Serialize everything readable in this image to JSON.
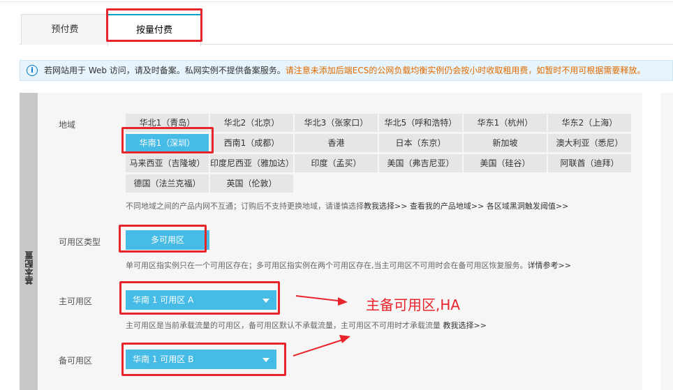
{
  "tabs": [
    {
      "label": "预付费"
    },
    {
      "label": "按量付费"
    }
  ],
  "info": {
    "normal": "若网站用于 Web 访问，请及时备案。私网实例不提供备案服务。",
    "warning": "请注意未添加后端ECS的公网负载均衡实例仍会按小时收取租用费，如暂时不用可根据需要释放。"
  },
  "side_label": "基本配置",
  "region": {
    "label": "地域",
    "rows": [
      [
        "华北1（青岛）",
        "华北2（北京）",
        "华北3（张家口）",
        "华北5（呼和浩特）",
        "华东1（杭州）",
        "华东2（上海）"
      ],
      [
        "华南1（深圳）",
        "西南1（成都）",
        "香港",
        "日本（东京）",
        "新加坡",
        "澳大利亚（悉尼）"
      ],
      [
        "马来西亚（吉隆坡）",
        "印度尼西亚（雅加达）",
        "印度（孟买）",
        "美国（弗吉尼亚）",
        "美国（硅谷）",
        "阿联酋（迪拜）"
      ],
      [
        "德国（法兰克福）",
        "英国（伦敦）"
      ]
    ],
    "selected": "华南1（深圳）",
    "hint": "不同地域之间的产品内网不互通；订购后不支持更换地域，请谨慎选择",
    "links": [
      "教我选择>>",
      "查看我的产品地域>>",
      "各区域黑洞触发阈值>>"
    ]
  },
  "zone_type": {
    "label": "可用区类型",
    "value": "多可用区",
    "hint": "单可用区指实例只在一个可用区存在；多可用区指实例在两个可用区存在,当主可用区不可用时会在备可用区恢复服务。",
    "link": "详情参考>>"
  },
  "primary_zone": {
    "label": "主可用区",
    "value": "华南 1 可用区 A",
    "hint": "主可用区是当前承载流量的可用区，备可用区默认不承载流量，主可用区不可用时才承载流量",
    "link": "教我选择>>"
  },
  "backup_zone": {
    "label": "备可用区",
    "value": "华南 1 可用区 B"
  },
  "annotation": "主备可用区,HA",
  "colors": {
    "accent": "#45bbe6",
    "highlight": "#e8242b",
    "warning": "#e06b00"
  }
}
